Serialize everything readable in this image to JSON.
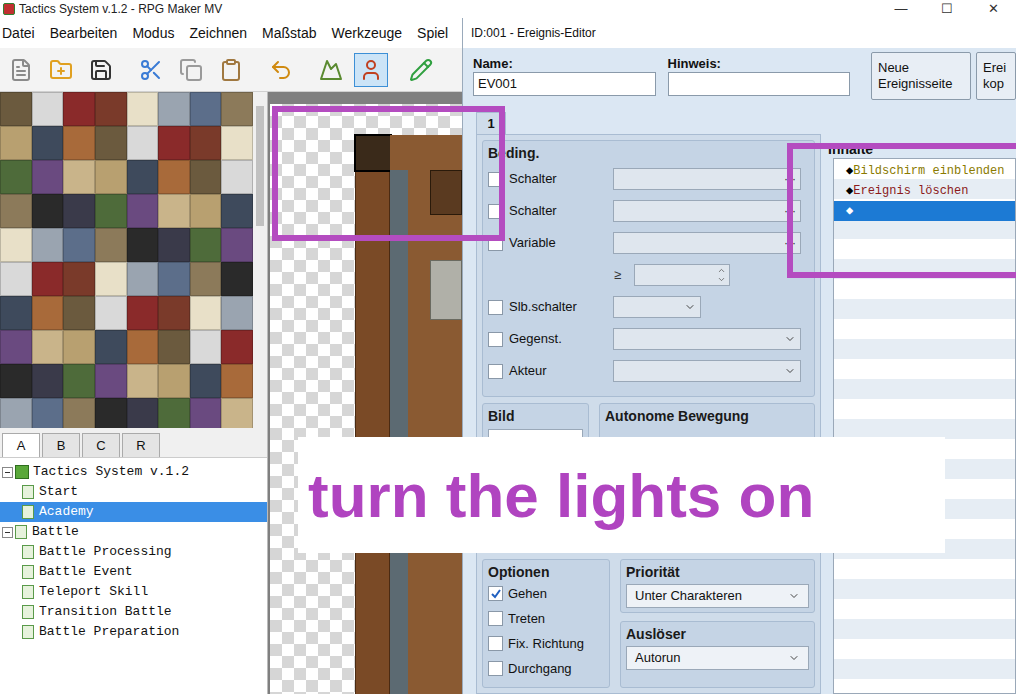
{
  "window": {
    "title": "Tactics System v.1.2 - RPG Maker MV",
    "controls": [
      "—",
      "☐",
      "✕"
    ]
  },
  "menu": [
    "Datei",
    "Bearbeiten",
    "Modus",
    "Zeichnen",
    "Maßstab",
    "Werkzeuge",
    "Spiel"
  ],
  "toolbar": [
    {
      "selected": false
    },
    {
      "selected": false
    },
    {
      "selected": false
    },
    {
      "selected": false
    },
    {
      "selected": false
    },
    {
      "selected": false
    },
    {
      "selected": false
    },
    {
      "selected": false
    },
    {
      "selected": true
    },
    {
      "selected": false
    }
  ],
  "tileset_tabs": [
    {
      "label": "A",
      "selected": true
    },
    {
      "label": "B",
      "selected": false
    },
    {
      "label": "C",
      "selected": false
    },
    {
      "label": "R",
      "selected": false
    }
  ],
  "tree": [
    {
      "label": "Tactics System v.1.2",
      "depth": 0,
      "kind": "root",
      "expanded": true,
      "selected": false
    },
    {
      "label": "Start",
      "depth": 1,
      "kind": "map",
      "selected": false
    },
    {
      "label": "Academy",
      "depth": 1,
      "kind": "map",
      "selected": true
    },
    {
      "label": "Battle",
      "depth": 0,
      "kind": "folder",
      "expanded": true,
      "selected": false
    },
    {
      "label": "Battle Processing",
      "depth": 1,
      "kind": "map",
      "selected": false
    },
    {
      "label": "Battle Event",
      "depth": 1,
      "kind": "map",
      "selected": false
    },
    {
      "label": "Teleport Skill",
      "depth": 1,
      "kind": "map",
      "selected": false
    },
    {
      "label": "Transition Battle",
      "depth": 1,
      "kind": "map",
      "selected": false
    },
    {
      "label": "Battle Preparation",
      "depth": 1,
      "kind": "map",
      "selected": false
    }
  ],
  "editor": {
    "title": "ID:001 - Ereignis-Editor",
    "name_label": "Name:",
    "name_value": "EV001",
    "note_label": "Hinweis:",
    "note_value": "",
    "buttons": [
      "Neue Ereignisseite",
      "Erei kop"
    ],
    "pages": [
      {
        "label": "1",
        "selected": true
      }
    ],
    "conditions_title": "Beding.",
    "conditions": [
      {
        "kind": "picker",
        "label": "Schalter",
        "checked": false,
        "button": "···"
      },
      {
        "kind": "picker",
        "label": "Schalter",
        "checked": false,
        "button": "···"
      },
      {
        "kind": "picker",
        "label": "Variable",
        "checked": false,
        "button": "···"
      },
      {
        "kind": "compare",
        "label": "≥"
      },
      {
        "kind": "small-select",
        "label": "Slb.schalter",
        "checked": false
      },
      {
        "kind": "select",
        "label": "Gegenst.",
        "checked": false
      },
      {
        "kind": "select",
        "label": "Akteur",
        "checked": false
      }
    ],
    "image_title": "Bild",
    "movement_title": "Autonome Bewegung",
    "options_title": "Optionen",
    "options": [
      {
        "label": "Gehen",
        "checked": true
      },
      {
        "label": "Treten",
        "checked": false
      },
      {
        "label": "Fix. Richtung",
        "checked": false
      },
      {
        "label": "Durchgang",
        "checked": false
      }
    ],
    "priority_title": "Priorität",
    "priority_value": "Unter Charakteren",
    "trigger_title": "Auslöser",
    "trigger_value": "Autorun",
    "contents_title": "Inhalte",
    "contents": [
      {
        "bullet": "◆",
        "text": "Bildschirm einblenden",
        "color": "#8a7a00",
        "selected": false
      },
      {
        "bullet": "◆",
        "text": "Ereignis löschen",
        "color": "#8b1a1a",
        "selected": false
      },
      {
        "bullet": "◆",
        "text": "",
        "color": "#ffffff",
        "selected": true
      }
    ]
  },
  "annotation": {
    "text": "turn the lights on"
  }
}
